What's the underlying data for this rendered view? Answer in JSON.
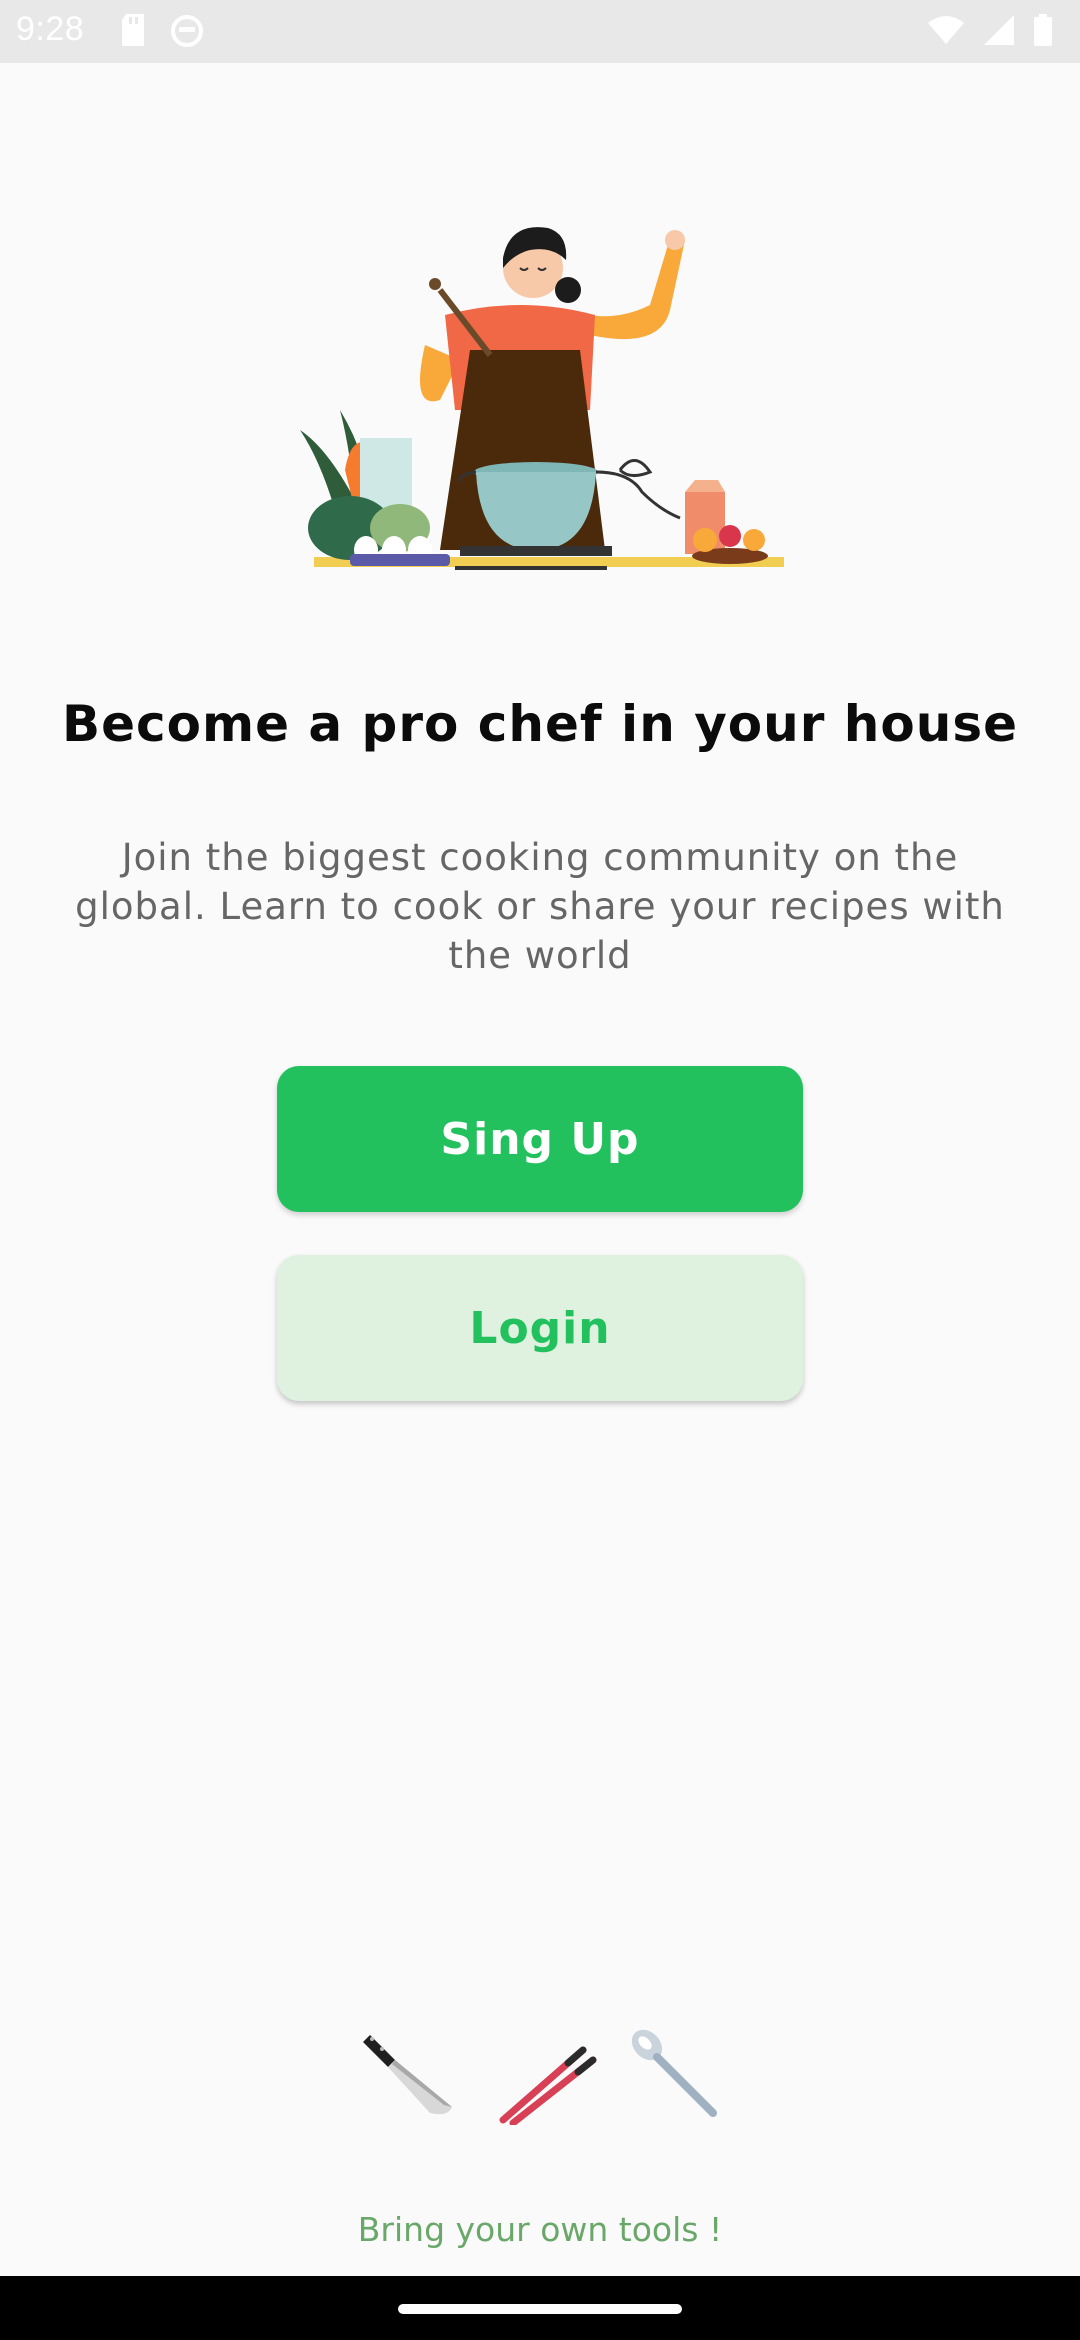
{
  "status_bar": {
    "time": "9:28",
    "left_icons": [
      "sd-card-icon",
      "notification-face-icon"
    ],
    "right_icons": [
      "wifi-icon",
      "signal-icon",
      "battery-icon"
    ]
  },
  "hero": {
    "illustration": "chef-cooking-illustration"
  },
  "headline": "Become a pro chef in your house",
  "subtitle": "Join the biggest cooking community on the global. Learn to cook or share your recipes with the world",
  "buttons": {
    "signup_label": "Sing Up",
    "login_label": "Login"
  },
  "tools": {
    "icons": [
      "knife-icon",
      "chopsticks-icon",
      "spoon-icon"
    ],
    "caption": "Bring your own tools !"
  },
  "colors": {
    "primary_green": "#22c15e",
    "login_bg": "#dff1df",
    "caption_green": "#6aa86a",
    "background": "#fafafa"
  }
}
